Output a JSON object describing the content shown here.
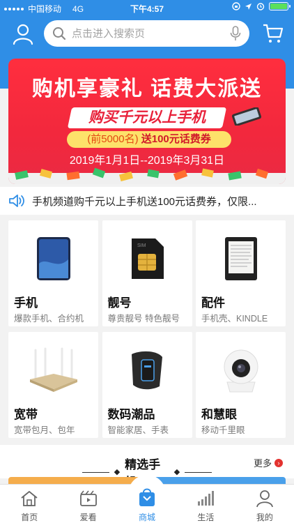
{
  "status_bar": {
    "carrier": "中国移动",
    "network": "4G",
    "time": "下午4:57",
    "battery_level": 1.0
  },
  "header": {
    "search_placeholder": "点击进入搜索页",
    "icons": [
      "user-icon",
      "search-icon",
      "microphone-icon",
      "cart-icon"
    ]
  },
  "banner": {
    "title": "购机享豪礼  话费大派送",
    "ribbon": "购买千元以上手机",
    "sub_prefix": "(前5000名)",
    "sub_main": "送100元话费券",
    "date": "2019年1月1日--2019年3月31日"
  },
  "notice": {
    "icon": "speaker-icon",
    "text": "手机频道购千元以上手机送100元话费券，仅限..."
  },
  "categories": [
    {
      "name": "手机",
      "desc": "爆款手机、合约机",
      "icon": "phone-product"
    },
    {
      "name": "靓号",
      "desc": "尊贵靓号 特色靓号",
      "icon": "sim-card-product"
    },
    {
      "name": "配件",
      "desc": "手机壳、KINDLE",
      "icon": "ereader-product"
    },
    {
      "name": "宽带",
      "desc": "宽带包月、包年",
      "icon": "router-product"
    },
    {
      "name": "数码潮品",
      "desc": "智能家居、手表",
      "icon": "smartband-product"
    },
    {
      "name": "和慧眼",
      "desc": "移动千里眼",
      "icon": "camera-product"
    }
  ],
  "featured": {
    "title": "精选手机",
    "more": "更多",
    "more_icon": "chevron-right-icon"
  },
  "tabbar": [
    {
      "label": "首页",
      "icon": "home-icon",
      "active": false
    },
    {
      "label": "爱看",
      "icon": "video-icon",
      "active": false
    },
    {
      "label": "商城",
      "icon": "shopping-bag-icon",
      "active": true
    },
    {
      "label": "生活",
      "icon": "signal-icon",
      "active": false
    },
    {
      "label": "我的",
      "icon": "profile-icon",
      "active": false
    }
  ],
  "colors": {
    "primary": "#2f8ee6",
    "banner_red": "#f2283d",
    "banner_yellow": "#fde26a",
    "more_red": "#e3322f"
  }
}
